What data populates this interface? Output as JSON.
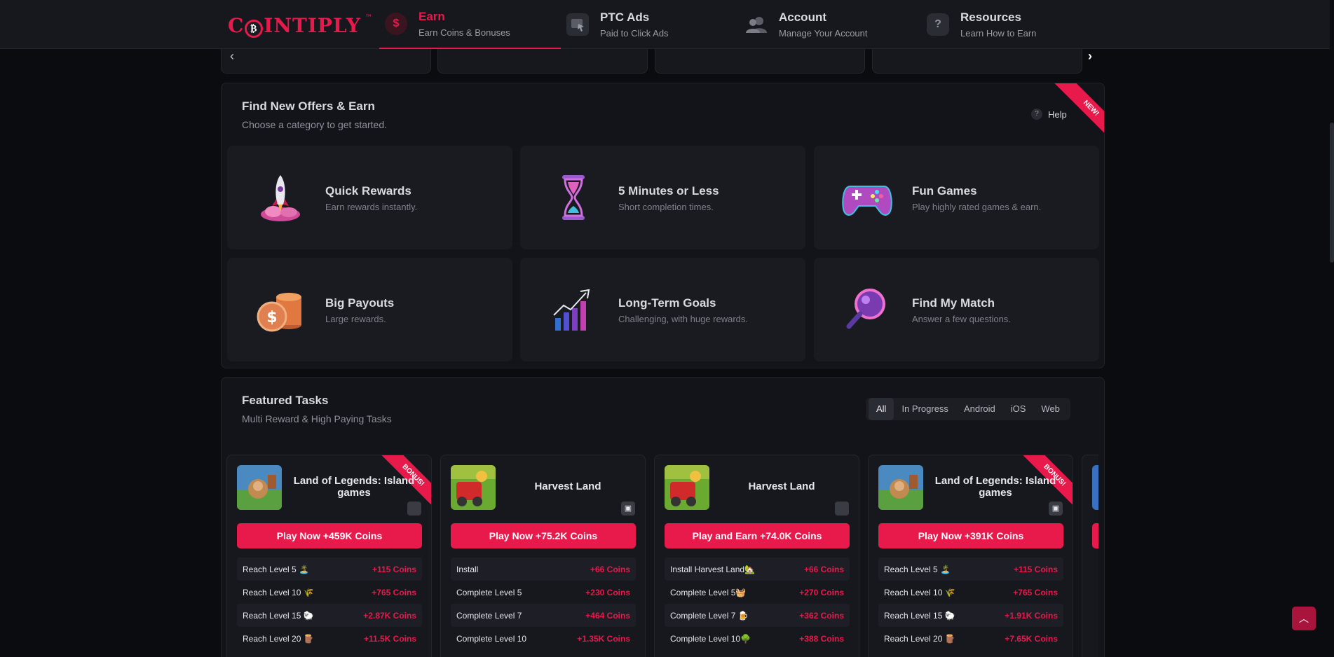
{
  "brand": {
    "logo": "C₿INTIPLY",
    "tm": "™"
  },
  "nav": [
    {
      "title": "Earn",
      "sub": "Earn Coins & Bonuses",
      "icon": "dollar-icon",
      "active": true
    },
    {
      "title": "PTC Ads",
      "sub": "Paid to Click Ads",
      "icon": "cursor-ad-icon"
    },
    {
      "title": "Account",
      "sub": "Manage Your Account",
      "icon": "users-icon"
    },
    {
      "title": "Resources",
      "sub": "Learn How to Earn",
      "icon": "question-icon"
    }
  ],
  "offers": {
    "title": "Find New Offers & Earn",
    "subtitle": "Choose a category to get started.",
    "ribbon": "NEW!",
    "help": "Help",
    "categories": [
      {
        "title": "Quick Rewards",
        "desc": "Earn rewards instantly.",
        "icon": "rocket-icon"
      },
      {
        "title": "5 Minutes or Less",
        "desc": "Short completion times.",
        "icon": "hourglass-icon"
      },
      {
        "title": "Fun Games",
        "desc": "Play highly rated games & earn.",
        "icon": "gamepad-icon"
      },
      {
        "title": "Big Payouts",
        "desc": "Large rewards.",
        "icon": "coins-icon"
      },
      {
        "title": "Long-Term Goals",
        "desc": "Challenging, with huge rewards.",
        "icon": "growth-chart-icon"
      },
      {
        "title": "Find My Match",
        "desc": "Answer a few questions.",
        "icon": "magnifier-icon"
      }
    ]
  },
  "featured": {
    "title": "Featured Tasks",
    "subtitle": "Multi Reward & High Paying Tasks",
    "filters": [
      "All",
      "In Progress",
      "Android",
      "iOS",
      "Web"
    ],
    "active_filter": "All",
    "tasks": [
      {
        "name": "Land of Legends: Island games",
        "bonus": "BONUS!",
        "platform": "apple-icon",
        "cta": "Play Now +459K Coins",
        "rewards": [
          {
            "label": "Reach Level 5 🏝️",
            "value": "+115 Coins"
          },
          {
            "label": "Reach Level 10 🌾",
            "value": "+765 Coins"
          },
          {
            "label": "Reach Level 15 🐑",
            "value": "+2.87K Coins"
          },
          {
            "label": "Reach Level 20 🪵",
            "value": "+11.5K Coins"
          }
        ]
      },
      {
        "name": "Harvest Land",
        "bonus": "",
        "platform": "android-icon",
        "cta": "Play Now +75.2K Coins",
        "rewards": [
          {
            "label": "Install",
            "value": "+66 Coins"
          },
          {
            "label": "Complete Level 5",
            "value": "+230 Coins"
          },
          {
            "label": "Complete Level 7",
            "value": "+464 Coins"
          },
          {
            "label": "Complete Level 10",
            "value": "+1.35K Coins"
          }
        ]
      },
      {
        "name": "Harvest Land",
        "bonus": "",
        "platform": "apple-icon",
        "cta": "Play and Earn +74.0K Coins",
        "rewards": [
          {
            "label": "Install Harvest Land🏡",
            "value": "+66 Coins"
          },
          {
            "label": "Complete Level 5🧺",
            "value": "+270 Coins"
          },
          {
            "label": "Complete Level 7 🍺",
            "value": "+362 Coins"
          },
          {
            "label": "Complete Level 10🌳",
            "value": "+388 Coins"
          }
        ]
      },
      {
        "name": "Land of Legends: Island games",
        "bonus": "BONUS!",
        "platform": "android-icon",
        "cta": "Play Now +391K Coins",
        "rewards": [
          {
            "label": "Reach Level 5 🏝️",
            "value": "+115 Coins"
          },
          {
            "label": "Reach Level 10 🌾",
            "value": "+765 Coins"
          },
          {
            "label": "Reach Level 15 🐑",
            "value": "+1.91K Coins"
          },
          {
            "label": "Reach Level 20 🪵",
            "value": "+7.65K Coins"
          }
        ]
      }
    ]
  },
  "colors": {
    "accent": "#e8194b",
    "bg": "#0b0c0f",
    "panel": "#131419",
    "card": "#1a1b21"
  }
}
